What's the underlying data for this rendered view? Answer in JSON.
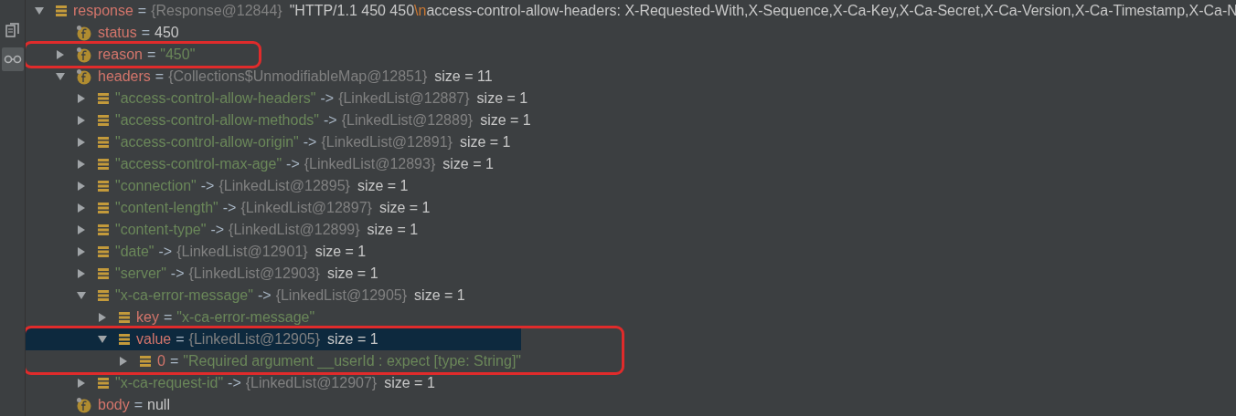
{
  "toolbar": [
    {
      "kind": "copy",
      "selected": false
    },
    {
      "kind": "glasses",
      "selected": true
    }
  ],
  "tree": [
    {
      "kind": "list",
      "name": "response",
      "color": "#d3756b",
      "op": "=",
      "type": "{Response@12844}",
      "value": [
        {
          "kind": "plain",
          "text": "\"HTTP/1.1 450 450"
        },
        {
          "kind": "escape",
          "text": "\\n"
        },
        {
          "kind": "plain",
          "text": "access-control-allow-headers: X-Requested-With,X-Sequence,X-Ca-Key,X-Ca-Secret,X-Ca-Version,X-Ca-Timestamp,X-Ca-N"
        }
      ],
      "expanded": true,
      "selected": false,
      "outlined": false,
      "children": [
        {
          "kind": "field",
          "name": "status",
          "color": "#d3756b",
          "op": "=",
          "value": [
            {
              "kind": "plain",
              "text": "450"
            }
          ],
          "leaf": true,
          "selected": false,
          "outlined": false
        },
        {
          "kind": "field",
          "name": "reason",
          "color": "#d3756b",
          "op": "=",
          "value": [
            {
              "kind": "string",
              "text": "\"450\""
            }
          ],
          "expanded": false,
          "selected": false,
          "outlined": true
        },
        {
          "kind": "field",
          "name": "headers",
          "color": "#d3756b",
          "op": "=",
          "type": "{Collections$UnmodifiableMap@12851}",
          "size": "size = 11",
          "expanded": true,
          "selected": false,
          "outlined": false,
          "children": [
            {
              "kind": "list",
              "name": "\"access-control-allow-headers\"",
              "color": "#6a8759",
              "op": "->",
              "type": "{LinkedList@12887}",
              "size": "size = 1",
              "expanded": false,
              "selected": false,
              "outlined": false
            },
            {
              "kind": "list",
              "name": "\"access-control-allow-methods\"",
              "color": "#6a8759",
              "op": "->",
              "type": "{LinkedList@12889}",
              "size": "size = 1",
              "expanded": false,
              "selected": false,
              "outlined": false
            },
            {
              "kind": "list",
              "name": "\"access-control-allow-origin\"",
              "color": "#6a8759",
              "op": "->",
              "type": "{LinkedList@12891}",
              "size": "size = 1",
              "expanded": false,
              "selected": false,
              "outlined": false
            },
            {
              "kind": "list",
              "name": "\"access-control-max-age\"",
              "color": "#6a8759",
              "op": "->",
              "type": "{LinkedList@12893}",
              "size": "size = 1",
              "expanded": false,
              "selected": false,
              "outlined": false
            },
            {
              "kind": "list",
              "name": "\"connection\"",
              "color": "#6a8759",
              "op": "->",
              "type": "{LinkedList@12895}",
              "size": "size = 1",
              "expanded": false,
              "selected": false,
              "outlined": false
            },
            {
              "kind": "list",
              "name": "\"content-length\"",
              "color": "#6a8759",
              "op": "->",
              "type": "{LinkedList@12897}",
              "size": "size = 1",
              "expanded": false,
              "selected": false,
              "outlined": false
            },
            {
              "kind": "list",
              "name": "\"content-type\"",
              "color": "#6a8759",
              "op": "->",
              "type": "{LinkedList@12899}",
              "size": "size = 1",
              "expanded": false,
              "selected": false,
              "outlined": false
            },
            {
              "kind": "list",
              "name": "\"date\"",
              "color": "#6a8759",
              "op": "->",
              "type": "{LinkedList@12901}",
              "size": "size = 1",
              "expanded": false,
              "selected": false,
              "outlined": false
            },
            {
              "kind": "list",
              "name": "\"server\"",
              "color": "#6a8759",
              "op": "->",
              "type": "{LinkedList@12903}",
              "size": "size = 1",
              "expanded": false,
              "selected": false,
              "outlined": false
            },
            {
              "kind": "list",
              "name": "\"x-ca-error-message\"",
              "color": "#6a8759",
              "op": "->",
              "type": "{LinkedList@12905}",
              "size": "size = 1",
              "expanded": true,
              "selected": false,
              "outlined": false,
              "children": [
                {
                  "kind": "list",
                  "name": "key",
                  "color": "#d3756b",
                  "op": "=",
                  "value": [
                    {
                      "kind": "string",
                      "text": "\"x-ca-error-message\""
                    }
                  ],
                  "expanded": false,
                  "selected": false,
                  "outlined": false
                },
                {
                  "kind": "list",
                  "name": "value",
                  "color": "#d3756b",
                  "op": "=",
                  "type": "{LinkedList@12905}",
                  "size": "size = 1",
                  "expanded": true,
                  "selected": true,
                  "outlined": true,
                  "children": [
                    {
                      "kind": "list",
                      "name": "0",
                      "color": "#d3756b",
                      "op": "=",
                      "value": [
                        {
                          "kind": "string",
                          "text": "\"Required argument __userId : expect [type: String]\""
                        }
                      ],
                      "expanded": false,
                      "selected": false,
                      "outlined": false
                    }
                  ]
                }
              ]
            },
            {
              "kind": "list",
              "name": "\"x-ca-request-id\"",
              "color": "#6a8759",
              "op": "->",
              "type": "{LinkedList@12907}",
              "size": "size = 1",
              "expanded": false,
              "selected": false,
              "outlined": false
            }
          ]
        },
        {
          "kind": "field",
          "name": "body",
          "color": "#d3756b",
          "op": "=",
          "value": [
            {
              "kind": "plain",
              "text": "null"
            }
          ],
          "leaf": true,
          "selected": false,
          "outlined": false
        }
      ]
    }
  ]
}
